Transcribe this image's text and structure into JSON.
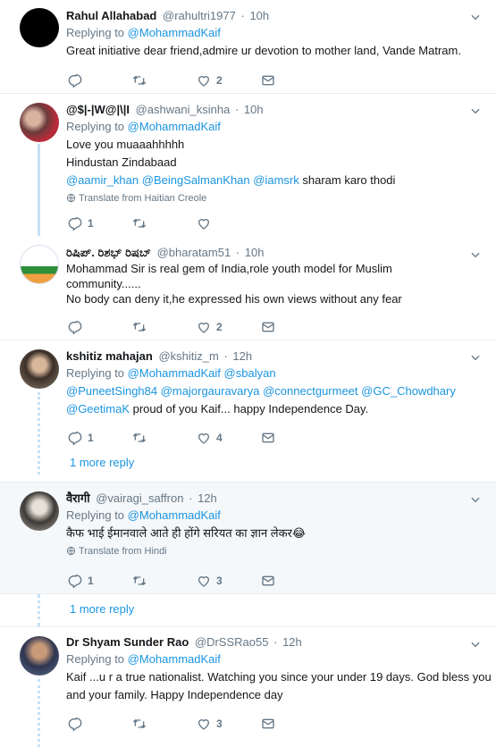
{
  "tweets": [
    {
      "name": "Rahul Allahabad",
      "handle": "@rahultri1977",
      "time": "10h",
      "reply_label": "Replying to",
      "reply_to": "@MohammadKaif",
      "lines": [
        "Great initiative dear friend,admire ur devotion to mother land, Vande Matram."
      ],
      "reply_count": "",
      "retweet_count": "",
      "like_count": "2"
    },
    {
      "name": "@$|-|W@|\\|I",
      "handle": "@ashwani_ksinha",
      "time": "10h",
      "reply_label": "Replying to",
      "reply_to": "@MohammadKaif",
      "lines": [
        "Love you muaaahhhhh",
        "Hindustan Zindabaad"
      ],
      "mentions": [
        "@aamir_khan",
        "@BeingSalmanKhan",
        "@iamsrk"
      ],
      "mention_tail": "sharam karo thodi",
      "translate": "Translate from Haitian Creole",
      "reply_count": "1",
      "retweet_count": "",
      "like_count": ""
    },
    {
      "name": "ರಿಷಿಪ್. ರಿಶಭ್ ರಿಷಬ್",
      "handle": "@bharatam51",
      "time": "10h",
      "lines": [
        "Mohammad Sir is real gem of India,role youth model for Muslim",
        "community......",
        "No body can deny it,he expressed his own views without any fear"
      ],
      "reply_count": "",
      "retweet_count": "",
      "like_count": "2"
    },
    {
      "name": "kshitiz mahajan",
      "handle": "@kshitiz_m",
      "time": "12h",
      "reply_label": "Replying to",
      "reply_to": "@MohammadKaif",
      "reply_to2": "@sbalyan",
      "mentions_line1": [
        "@PuneetSingh84",
        "@majorgauravarya",
        "@connectgurmeet",
        "@GC_Chowdhary"
      ],
      "mention_line2_link": "@GeetimaK",
      "mention_line2_tail": "proud of you Kaif... happy Independence Day.",
      "reply_count": "1",
      "retweet_count": "",
      "like_count": "4",
      "more_reply": "1 more reply"
    },
    {
      "name": "वैरागी",
      "handle": "@vairagi_saffron",
      "time": "12h",
      "reply_label": "Replying to",
      "reply_to": "@MohammadKaif",
      "lines": [
        "कैफ भाई ईमानवाले आते ही होंगे सरियत का ज्ञान लेकर😂"
      ],
      "translate": "Translate from Hindi",
      "reply_count": "1",
      "retweet_count": "",
      "like_count": "3",
      "more_reply": "1 more reply"
    },
    {
      "name": "Dr Shyam Sunder Rao",
      "handle": "@DrSSRao55",
      "time": "12h",
      "reply_label": "Replying to",
      "reply_to": "@MohammadKaif",
      "lines": [
        "Kaif ...u r a true nationalist. Watching you since your under 19 days. God bless you",
        "and your family. Happy Independence day"
      ],
      "reply_count": "",
      "retweet_count": "",
      "like_count": "3"
    }
  ],
  "separator_dot": "·",
  "colors": {
    "link": "#1b95e0",
    "muted": "#657786",
    "thread": "#c4e1f6",
    "highlight_bg": "#f5f8fa"
  },
  "icons": [
    "reply-icon",
    "retweet-icon",
    "like-icon",
    "message-icon",
    "chevron-down-icon",
    "globe-icon"
  ]
}
